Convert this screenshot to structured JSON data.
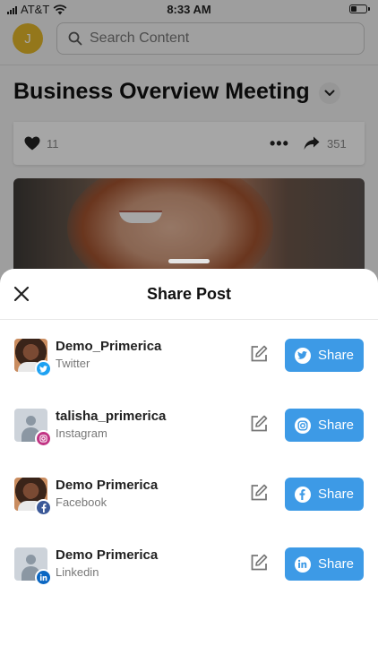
{
  "status_bar": {
    "carrier": "AT&T",
    "time": "8:33 AM"
  },
  "header": {
    "avatar_initial": "J",
    "search_placeholder": "Search Content"
  },
  "page": {
    "title": "Business Overview Meeting"
  },
  "post": {
    "likes": "11",
    "shares": "351"
  },
  "sheet": {
    "title": "Share Post",
    "accounts": [
      {
        "name": "Demo_Primerica",
        "network": "Twitter",
        "share_label": "Share",
        "avatar": "photo",
        "icon": "twitter-icon",
        "color": "#1da1f2"
      },
      {
        "name": "talisha_primerica",
        "network": "Instagram",
        "share_label": "Share",
        "avatar": "generic",
        "icon": "instagram-icon",
        "color": "#c13584"
      },
      {
        "name": "Demo Primerica",
        "network": "Facebook",
        "share_label": "Share",
        "avatar": "photo",
        "icon": "facebook-icon",
        "color": "#3b5998"
      },
      {
        "name": "Demo Primerica",
        "network": "Linkedin",
        "share_label": "Share",
        "avatar": "generic",
        "icon": "linkedin-icon",
        "color": "#0a66c2"
      }
    ]
  },
  "colors": {
    "accent": "#3d9ae6",
    "avatar_bg": "#e3b72a"
  }
}
